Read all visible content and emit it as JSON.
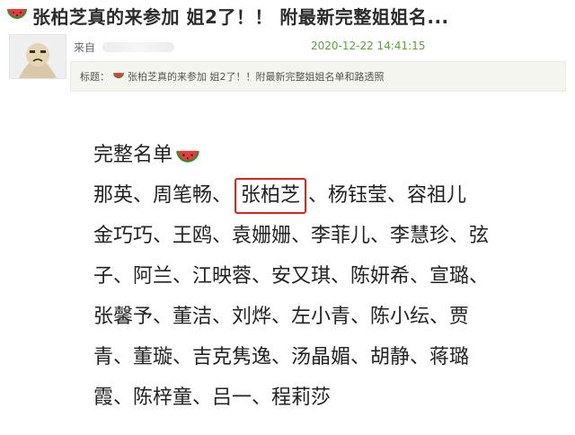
{
  "post": {
    "title": "张柏芝真的来参加 姐2了！！ 附最新完整姐姐名...",
    "title_icon": "watermelon-icon",
    "from_label": "来自",
    "datetime": "2020-12-22 14:41:15",
    "subject_label": "标题：",
    "subject_text": "张柏芝真的来参加  姐2了！！附最新完整姐姐名单和路透照",
    "accent_color": "#5aa23a",
    "highlight_color": "#d7261e"
  },
  "roster": {
    "heading": "完整名单",
    "separator": "、",
    "line1": {
      "before": "那英、周笔畅",
      "highlight": "张柏芝",
      "after": "、杨钰莹、容祖儿"
    },
    "lines": [
      "金巧巧、王鸥、袁姗姗、李菲儿、李慧珍、弦",
      "子、阿兰、江映蓉、安又琪、陈妍希、宣璐、",
      "张馨予、董洁、刘烨、左小青、陈小纭、贾",
      "青、董璇、吉克隽逸、汤晶媚、胡静、蒋璐",
      "霞、陈梓童、吕一、程莉莎"
    ]
  }
}
